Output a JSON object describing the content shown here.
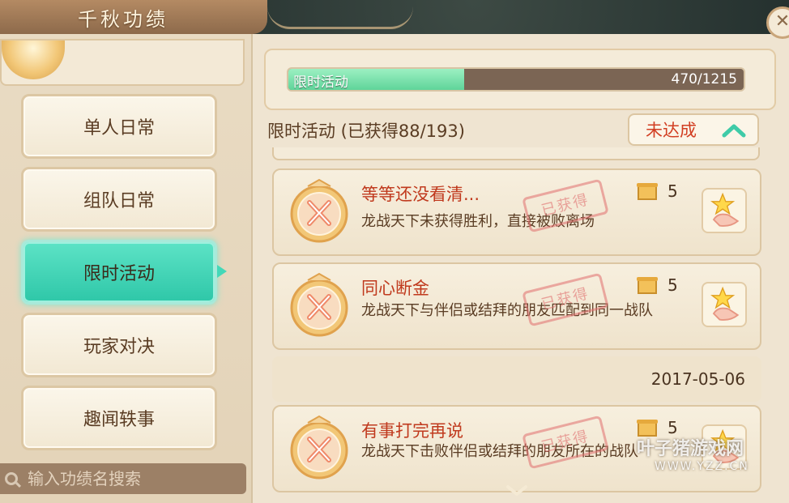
{
  "window": {
    "title": "千秋功绩",
    "close_label": "✕"
  },
  "sidebar": {
    "items": [
      {
        "label": "单人日常"
      },
      {
        "label": "组队日常"
      },
      {
        "label": "限时活动",
        "active": true
      },
      {
        "label": "玩家对决"
      },
      {
        "label": "趣闻轶事"
      }
    ],
    "search": {
      "placeholder": "输入功绩名搜索",
      "value": ""
    }
  },
  "progress": {
    "label": "限时活动",
    "value_text": "470/1215",
    "fraction": 0.387,
    "fill_color": "#6cd9a2"
  },
  "section": {
    "title": "限时活动  (已获得88/193)",
    "filter_label": "未达成"
  },
  "achievements": [
    {
      "name": "等等还没看清...",
      "desc": "龙战天下未获得胜利，直接被败离场",
      "reward": "5",
      "stamp": "已获得"
    },
    {
      "name": "同心断金",
      "desc": "龙战天下与伴侣或结拜的朋友匹配到同一战队",
      "reward": "5",
      "stamp": "已获得"
    },
    {
      "name": "有事打完再说",
      "desc": "龙战天下击败伴侣或结拜的朋友所在的战队",
      "reward": "5",
      "stamp": "已获得"
    }
  ],
  "date_separator": "2017-05-06",
  "watermark": {
    "main": "叶子猪游戏网",
    "sub": "WWW.YZZ.CN"
  },
  "colors": {
    "accent_active": "#2ec7a8",
    "name_red": "#c0391d",
    "filter_red": "#d23e22",
    "parchment": "#efe4d1"
  }
}
